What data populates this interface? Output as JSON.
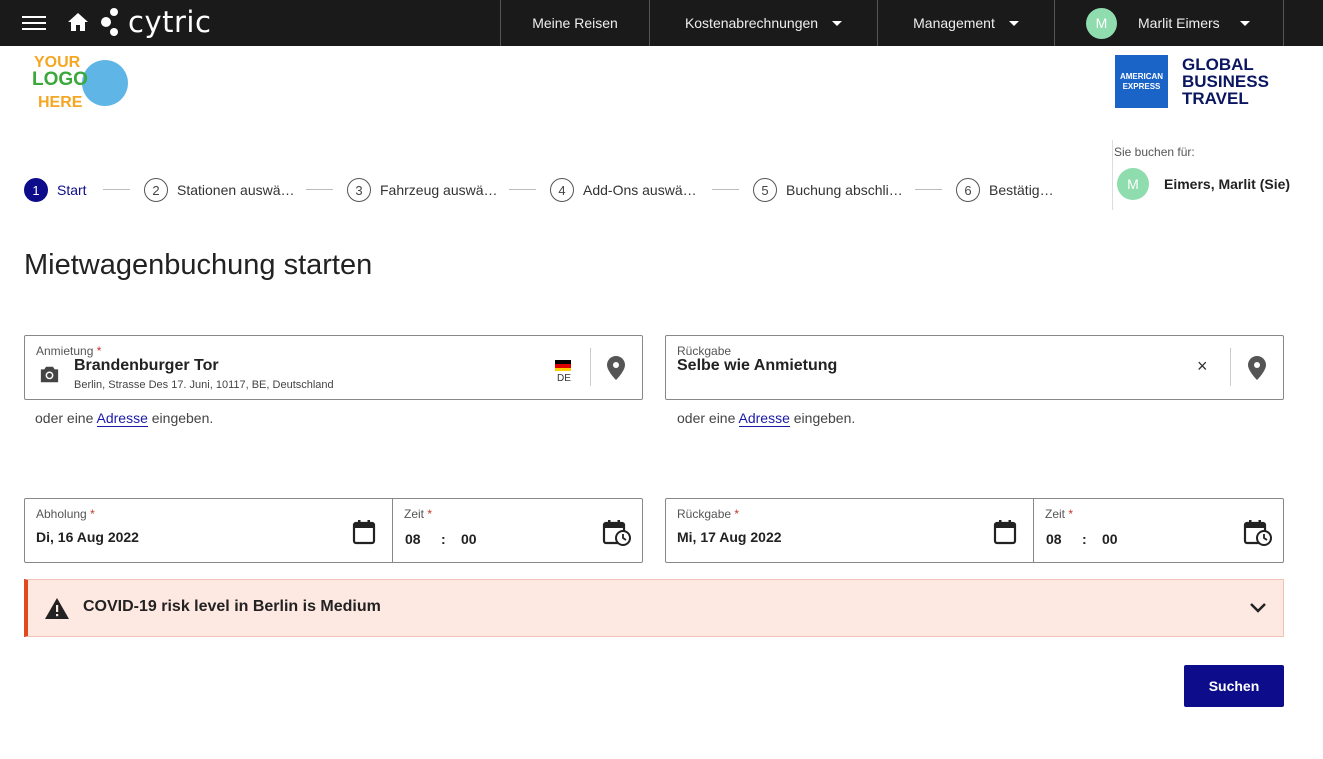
{
  "topbar": {
    "brand": "cytric",
    "nav": [
      {
        "label": "Meine Reisen"
      },
      {
        "label": "Kostenabrechnungen"
      },
      {
        "label": "Management"
      }
    ],
    "user": {
      "initial": "M",
      "name": "Marlit Eimers"
    }
  },
  "logos": {
    "customer": [
      "YOUR",
      "LOGO",
      "HERE"
    ],
    "amex_box": [
      "AMERICAN",
      "EXPRESS"
    ],
    "amex_text": [
      "GLOBAL",
      "BUSINESS",
      "TRAVEL"
    ]
  },
  "booking_for": {
    "label": "Sie buchen für:",
    "initial": "M",
    "name": "Eimers, Marlit (Sie)"
  },
  "steps": [
    {
      "num": "1",
      "label": "Start",
      "active": true
    },
    {
      "num": "2",
      "label": "Stationen auswä…"
    },
    {
      "num": "3",
      "label": "Fahrzeug auswä…"
    },
    {
      "num": "4",
      "label": "Add-Ons auswä…"
    },
    {
      "num": "5",
      "label": "Buchung abschli…"
    },
    {
      "num": "6",
      "label": "Bestätig…"
    }
  ],
  "page_title": "Mietwagenbuchung starten",
  "pickup": {
    "label": "Anmietung",
    "required": "*",
    "value": "Brandenburger Tor",
    "address": "Berlin, Strasse Des 17. Juni, 10117, BE, Deutschland",
    "country": "DE",
    "hint_prefix": "oder eine",
    "hint_link": "Adresse",
    "hint_suffix": "eingeben."
  },
  "return": {
    "label": "Rückgabe",
    "value": "Selbe wie Anmietung",
    "clear": "×",
    "hint_prefix": "oder eine",
    "hint_link": "Adresse",
    "hint_suffix": "eingeben."
  },
  "pickup_date": {
    "label": "Abholung",
    "required": "*",
    "value": "Di, 16 Aug 2022"
  },
  "pickup_time": {
    "label": "Zeit",
    "required": "*",
    "hour": "08",
    "colon": ":",
    "minute": "00"
  },
  "return_date": {
    "label": "Rückgabe",
    "required": "*",
    "value": "Mi, 17 Aug 2022"
  },
  "return_time": {
    "label": "Zeit",
    "required": "*",
    "hour": "08",
    "colon": ":",
    "minute": "00"
  },
  "covid": {
    "text": "COVID-19 risk level in Berlin is Medium"
  },
  "search_button": "Suchen",
  "colors": {
    "primary": "#0d0d8c",
    "topbar": "#1a1a1a",
    "alert_bg": "#fde8e2",
    "alert_accent": "#e0491b",
    "avatar": "#8fdcae"
  }
}
